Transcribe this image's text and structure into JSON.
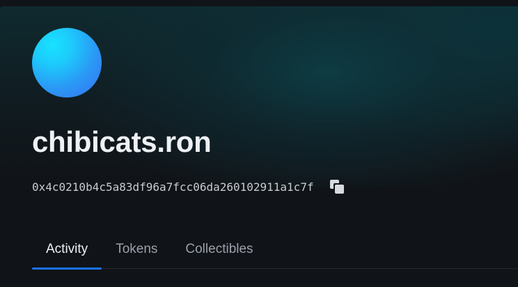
{
  "profile": {
    "name": "chibicats.ron",
    "address": "0x4c0210b4c5a83df96a7fcc06da260102911a1c7f",
    "copy_icon": "copy-icon",
    "avatar_colors": [
      "#19e1ff",
      "#3a6ef0"
    ]
  },
  "tabs": [
    {
      "label": "Activity",
      "active": true
    },
    {
      "label": "Tokens",
      "active": false
    },
    {
      "label": "Collectibles",
      "active": false
    }
  ],
  "colors": {
    "background": "#101317",
    "accent": "#1b73ff",
    "text_primary": "#eef1f5",
    "text_secondary": "#9aa1ab"
  }
}
